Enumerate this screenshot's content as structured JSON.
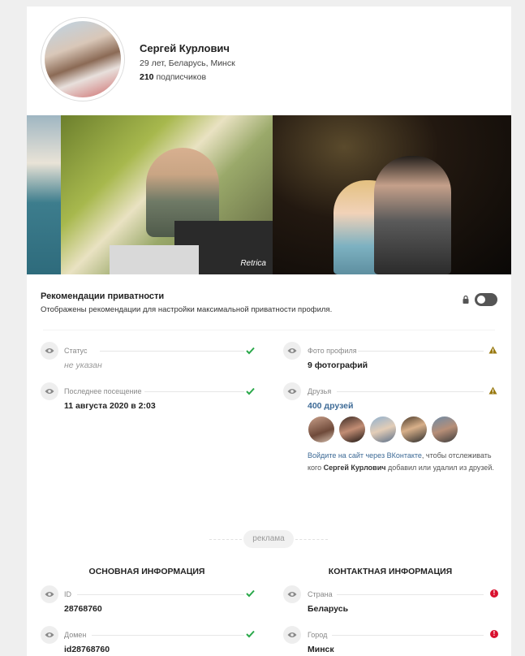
{
  "profile": {
    "name": "Сергей Курлович",
    "subtitle": "29 лет, Беларусь, Минск",
    "followers_count": "210",
    "followers_label": "подписчиков"
  },
  "photos": {
    "watermark": "Retrica"
  },
  "privacy": {
    "title": "Рекомендации приватности",
    "description": "Отображены рекомендации для настройки максимальной приватности профиля.",
    "toggle_on": false
  },
  "fields": {
    "status": {
      "label": "Статус",
      "value": "не указан",
      "state": "ok"
    },
    "last_seen": {
      "label": "Последнее посещение",
      "value": "11 августа 2020 в 2:03",
      "state": "ok"
    },
    "photo": {
      "label": "Фото профиля",
      "value": "9 фотографий",
      "state": "warning"
    },
    "friends": {
      "label": "Друзья",
      "value": "400 друзей",
      "state": "warning"
    }
  },
  "friends_note": {
    "link": "Войдите на сайт через ВКонтакте",
    "text1": ", чтобы отслеживать кого ",
    "name": "Сергей Курлович",
    "text2": " добавил или удалил из друзей."
  },
  "ad": {
    "label": "реклама"
  },
  "basic_info": {
    "title": "ОСНОВНАЯ ИНФОРМАЦИЯ",
    "id": {
      "label": "ID",
      "value": "28768760",
      "state": "ok"
    },
    "domain": {
      "label": "Домен",
      "value": "id28768760",
      "state": "ok"
    }
  },
  "contact_info": {
    "title": "КОНТАКТНАЯ ИНФОРМАЦИЯ",
    "country": {
      "label": "Страна",
      "value": "Беларусь",
      "state": "error"
    },
    "city": {
      "label": "Город",
      "value": "Минск",
      "state": "error"
    }
  },
  "colors": {
    "ok": "#2aa84a",
    "warning": "#9a7a12",
    "error": "#d9112f",
    "link": "#3d6a96"
  }
}
